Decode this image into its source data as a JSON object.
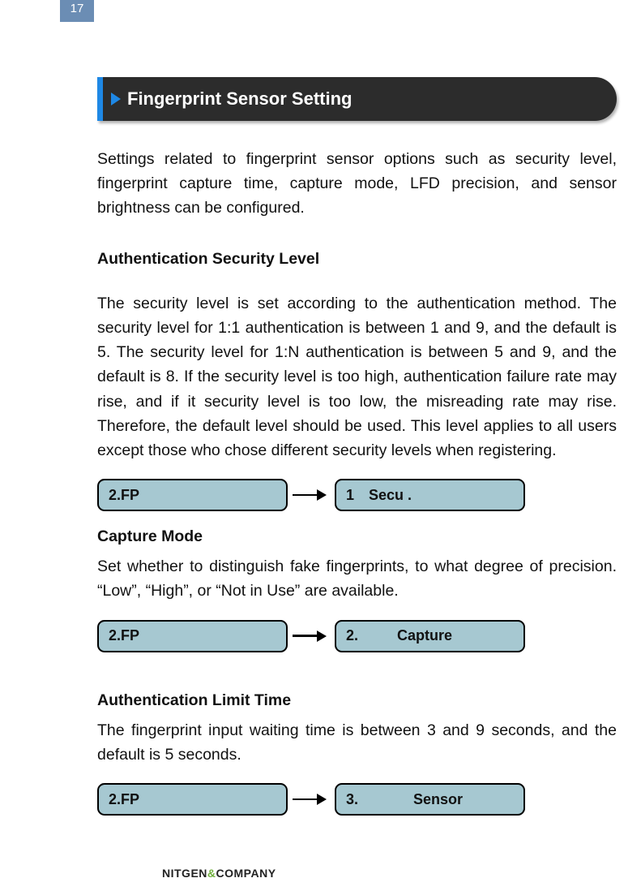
{
  "page_number": "17",
  "title": "Fingerprint Sensor Setting",
  "intro": "Settings related to fingerprint sensor options such as security level, fingerprint capture time, capture mode, LFD precision, and sensor brightness can be configured.",
  "sections": [
    {
      "heading": "Authentication Security Level",
      "body": "The security level is set according to the authentication method. The security level for 1:1 authentication is between 1 and 9, and the default is 5. The security level for 1:N authentication is between 5 and 9, and the default is 8. If the security level is too high, authentication failure rate may rise, and if it security level is too low, the misreading rate may rise. Therefore, the default level should be used. This level applies to all users except those who chose different security levels when registering.",
      "flow_from": "2.FP",
      "flow_to_num": "1",
      "flow_to_label": "Secu ."
    },
    {
      "heading": "Capture Mode",
      "body": "Set whether to distinguish fake fingerprints, to what degree of precision. “Low”, “High”, or “Not in Use” are available.",
      "flow_from": "2.FP",
      "flow_to_num": "2.",
      "flow_to_label": "Capture"
    },
    {
      "heading": "Authentication Limit Time",
      "body": "The fingerprint input waiting time is between 3 and 9 seconds, and the default is 5 seconds.",
      "flow_from": "2.FP",
      "flow_to_num": "3.",
      "flow_to_label": "Sensor"
    }
  ],
  "footer_brand_a": "NITGEN",
  "footer_amp": "&",
  "footer_brand_b": "COMPANY"
}
